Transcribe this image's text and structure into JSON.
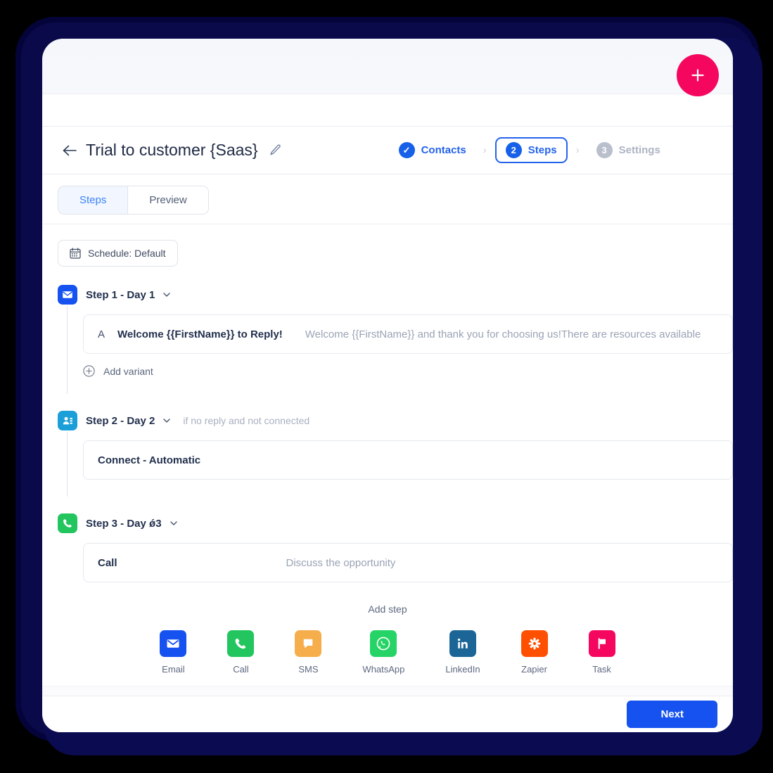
{
  "window": {
    "fab_label": "+",
    "fab_color": "#f5075f"
  },
  "header": {
    "back_label": "Back",
    "title": "Trial to customer {Saas}",
    "edit_label": "Edit name"
  },
  "stepper": {
    "items": [
      {
        "label": "Contacts",
        "badge": "✓",
        "state": "done"
      },
      {
        "label": "Steps",
        "badge": "2",
        "state": "active"
      },
      {
        "label": "Settings",
        "badge": "3",
        "state": "todo"
      }
    ],
    "separator": "›",
    "accent": "#2563eb"
  },
  "tabs": [
    {
      "label": "Steps",
      "selected": true
    },
    {
      "label": "Preview",
      "selected": false
    }
  ],
  "schedule": {
    "label": "Schedule: Default",
    "icon": "calendar-icon"
  },
  "steps": [
    {
      "title": "Step 1 - Day 1",
      "icon": "email-icon",
      "icon_color": "#1652f0",
      "condition": "",
      "card_type": "variant",
      "variant_letter": "A",
      "subject": "Welcome {{FirstName}} to Reply!",
      "preview": "Welcome {{FirstName}} and thank you for choosing us!There are resources available",
      "add_variant_label": "Add variant"
    },
    {
      "title": "Step 2 - Day  2",
      "icon": "connect-icon",
      "icon_color": "#1b9fd8",
      "condition": "if no reply and not connected",
      "card_type": "plain",
      "card_title": "Connect - Automatic",
      "card_note": ""
    },
    {
      "title": "Step 3 - Day ᴓ1гЧ3",
      "title_display": "Step 3 - Day ǿ3",
      "icon": "call-icon",
      "icon_color": "#22c55e",
      "condition": "",
      "card_type": "plain",
      "card_title": "Call",
      "card_note": "Discuss the opportunity"
    }
  ],
  "add_step": {
    "label": "Add step",
    "channels": [
      {
        "label": "Email",
        "icon": "email-icon",
        "color": "#1652f0"
      },
      {
        "label": "Call",
        "icon": "call-icon",
        "color": "#22c55e"
      },
      {
        "label": "SMS",
        "icon": "sms-icon",
        "color": "#f6ae4c"
      },
      {
        "label": "WhatsApp",
        "icon": "whatsapp-icon",
        "color": "#25d366"
      },
      {
        "label": "LinkedIn",
        "icon": "linkedin-icon",
        "color": "#1b6697"
      },
      {
        "label": "Zapier",
        "icon": "zapier-icon",
        "color": "#ff4f00"
      },
      {
        "label": "Task",
        "icon": "task-flag-icon",
        "color": "#f5075f"
      }
    ]
  },
  "footer": {
    "next_label": "Next",
    "next_color": "#1652f0"
  }
}
